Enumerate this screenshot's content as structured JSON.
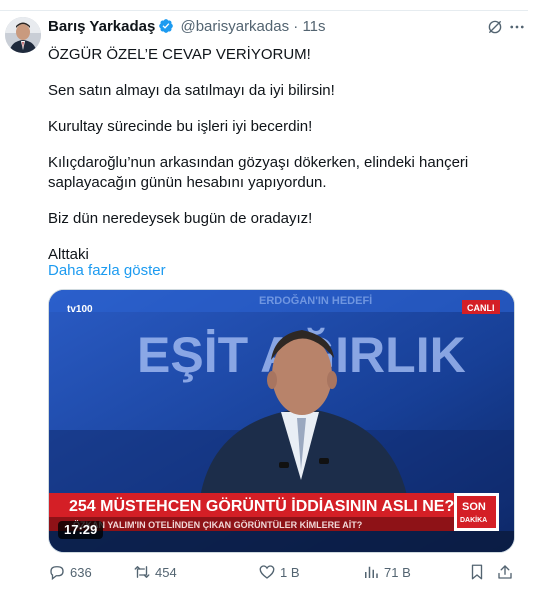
{
  "tweet": {
    "author_name": "Barış Yarkadaş",
    "handle": "@barisyarkadas",
    "separator": "·",
    "time": "11s",
    "lines": [
      "ÖZGÜR ÖZEL’E CEVAP VERİYORUM!",
      "Sen satın almayı da satılmayı da iyi bilirsin!",
      "Kurultay sürecinde bu işleri iyi  becerdin!",
      "Kılıçdaroğlu’nun arkasından gözyaşı dökerken, elindeki hançeri",
      "saplayacağın günün hesabını yapıyordun.",
      "Biz dün neredeysek bugün de oradayız!",
      "Alttaki"
    ],
    "show_more": "Daha fazla göster"
  },
  "media": {
    "channel_logo": "tv100",
    "live_badge": "CANLI",
    "studio_text": "EŞİT AĞIRLIK",
    "top_text": "ERDOĞAN'IN HEDEFİ",
    "headline": "254 MÜSTEHCEN GÖRÜNTÜ İDDİASININ ASLI NE?",
    "subline": "ÖZKAN YALIM'IN OTELİNDEN ÇIKAN GÖRÜNTÜLER KİMLERE AİT?",
    "son_dakika": [
      "SON",
      "DAKİKA"
    ],
    "duration": "17:29"
  },
  "actions": {
    "replies": "636",
    "reposts": "454",
    "likes": "1 B",
    "views": "71 B"
  },
  "colors": {
    "accent": "#1d9bf0",
    "verified": "#1d9bf0",
    "secondary_text": "#536471",
    "news_red": "#d41f26"
  },
  "icons": [
    "verified-icon",
    "grok-icon",
    "more-icon",
    "reply-icon",
    "repost-icon",
    "like-icon",
    "views-icon",
    "bookmark-icon",
    "share-icon"
  ]
}
